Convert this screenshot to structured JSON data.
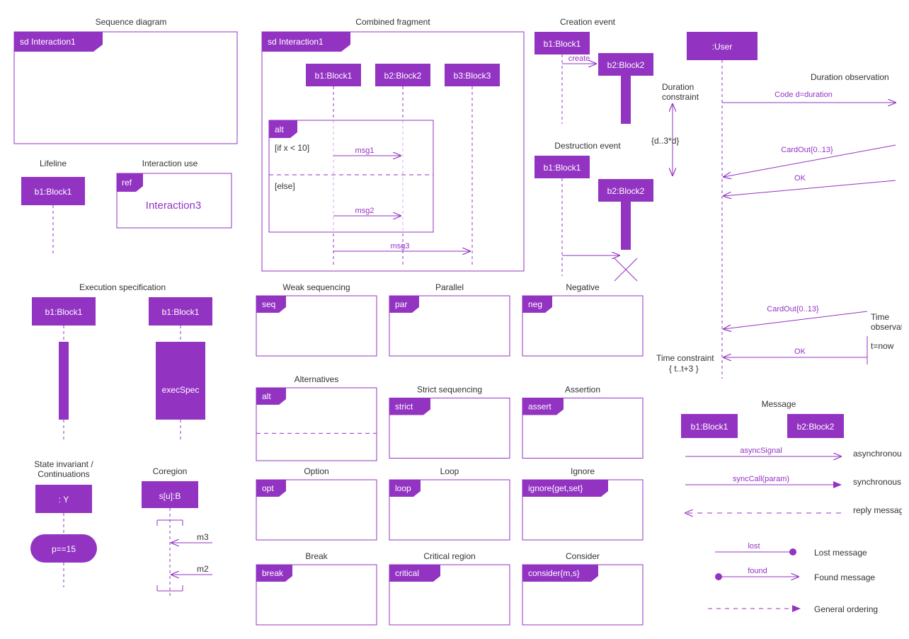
{
  "col1": {
    "seqDiagram": {
      "title": "Sequence diagram",
      "header": "sd  Interaction1"
    },
    "lifeline": {
      "title": "Lifeline",
      "block": "b1:Block1"
    },
    "interactionUse": {
      "title": "Interaction use",
      "tag": "ref",
      "body": "Interaction3"
    },
    "execSpec": {
      "title": "Execution specification",
      "block1": "b1:Block1",
      "block2": "b1:Block1",
      "label": "execSpec"
    },
    "stateInv": {
      "title": "State invariant /",
      "title2": "Continuations",
      "block": ": Y",
      "oval": "p==15"
    },
    "coregion": {
      "title": "Coregion",
      "block": "s[u]:B",
      "m3": "m3",
      "m2": "m2"
    }
  },
  "col2": {
    "combined": {
      "title": "Combined fragment",
      "header": "sd  Interaction1",
      "b1": "b1:Block1",
      "b2": "b2:Block2",
      "b3": "b3:Block3",
      "alt": "alt",
      "cond1": "[if x < 10]",
      "cond2": "[else]",
      "msg1": "msg1",
      "msg2": "msg2",
      "msg3": "msg3"
    },
    "frags": [
      {
        "title": "Weak sequencing",
        "tag": "seq"
      },
      {
        "title": "Parallel",
        "tag": "par"
      },
      {
        "title": "Negative",
        "tag": "neg"
      },
      {
        "title": "Alternatives",
        "tag": "alt",
        "dashed": true
      },
      {
        "title": "Strict sequencing",
        "tag": "strict"
      },
      {
        "title": "Assertion",
        "tag": "assert"
      },
      {
        "title": "Option",
        "tag": "opt"
      },
      {
        "title": "Loop",
        "tag": "loop"
      },
      {
        "title": "Ignore",
        "tag": "ignore{get,set}"
      },
      {
        "title": "Break",
        "tag": "break"
      },
      {
        "title": "Critical region",
        "tag": "critical"
      },
      {
        "title": "Consider",
        "tag": "consider{m,s}"
      }
    ]
  },
  "col3": {
    "creation": {
      "title": "Creation event",
      "b1": "b1:Block1",
      "b2": "b2:Block2",
      "msg": "create"
    },
    "destruction": {
      "title": "Destruction event",
      "b1": "b1:Block1",
      "b2": "b2:Block2"
    }
  },
  "col4": {
    "user": ":User",
    "durObs": "Duration observation",
    "durCon": "Duration",
    "durCon2": "constraint",
    "code": "Code d=duration",
    "dbrace": "{d..3*d}",
    "cardOut": "CardOut{0..13}",
    "ok": "OK",
    "timeObs": "Time",
    "timeObs2": "observation",
    "tnow": "t=now",
    "timeCon": "Time constraint",
    "tbrace": "{ t..t+3 }",
    "msgTitle": "Message",
    "b1": "b1:Block1",
    "b2": "b2:Block2",
    "async": "asyncSignal",
    "asyncR": "asynchronous signal",
    "sync": "syncCall(param)",
    "syncR": "synchronous call",
    "reply": "reply message",
    "lost": "lost",
    "lostR": "Lost message",
    "found": "found",
    "foundR": "Found message",
    "general": "General ordering"
  },
  "colors": {
    "p": "#9333c2"
  }
}
